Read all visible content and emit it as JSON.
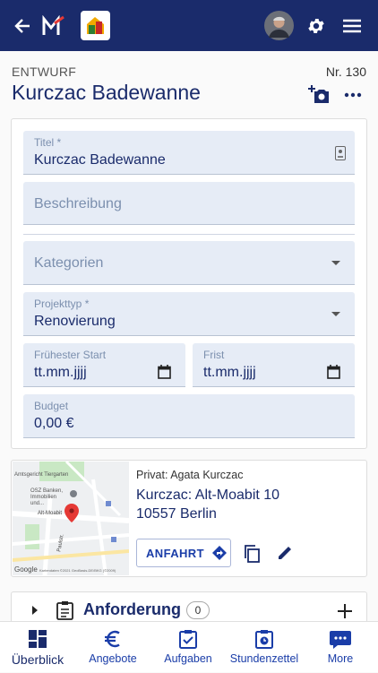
{
  "header": {
    "back_icon": "arrow-left-icon",
    "logo_icon": "m-logo-icon",
    "app_icon": "house-app-icon",
    "settings_icon": "gear-icon",
    "menu_icon": "hamburger-icon"
  },
  "project": {
    "status": "ENTWURF",
    "number": "Nr. 130",
    "title": "Kurczac Badewanne"
  },
  "form": {
    "titel_label": "Titel *",
    "titel_value": "Kurczac Badewanne",
    "beschreibung_placeholder": "Beschreibung",
    "kategorien_placeholder": "Kategorien",
    "projekttyp_label": "Projekttyp *",
    "projekttyp_value": "Renovierung",
    "start_label": "Frühester Start",
    "start_value": "tt.mm.jjjj",
    "frist_label": "Frist",
    "frist_value": "tt.mm.jjjj",
    "budget_label": "Budget",
    "budget_value": "0,00 €"
  },
  "address": {
    "client": "Privat: Agata Kurczac",
    "name": "Kurczac: Alt-Moabit 10",
    "city": "10557 Berlin",
    "directions_label": "ANFAHRT",
    "map_labels": {
      "amtsgericht": "Amtsgericht Tiergarten",
      "osz": "OSZ Banken, Immobilien und...",
      "altmoabit": "Alt-Moabit",
      "paulstr": "Paulstr.",
      "credit": "Kartendaten ©2021 GeoBasis-DE/BKG (©2009)",
      "google": "Google"
    }
  },
  "section": {
    "label": "Anforderung",
    "count": "0"
  },
  "bottom_nav": [
    {
      "label": "Überblick",
      "icon": "dashboard-icon"
    },
    {
      "label": "Angebote",
      "icon": "euro-icon"
    },
    {
      "label": "Aufgaben",
      "icon": "clipboard-check-icon"
    },
    {
      "label": "Stundenzettel",
      "icon": "clipboard-clock-icon"
    },
    {
      "label": "More",
      "icon": "more-icon"
    }
  ],
  "colors": {
    "primary": "#1a2b6b",
    "accent": "#1a3da8",
    "field_bg": "#e6ecf6"
  }
}
